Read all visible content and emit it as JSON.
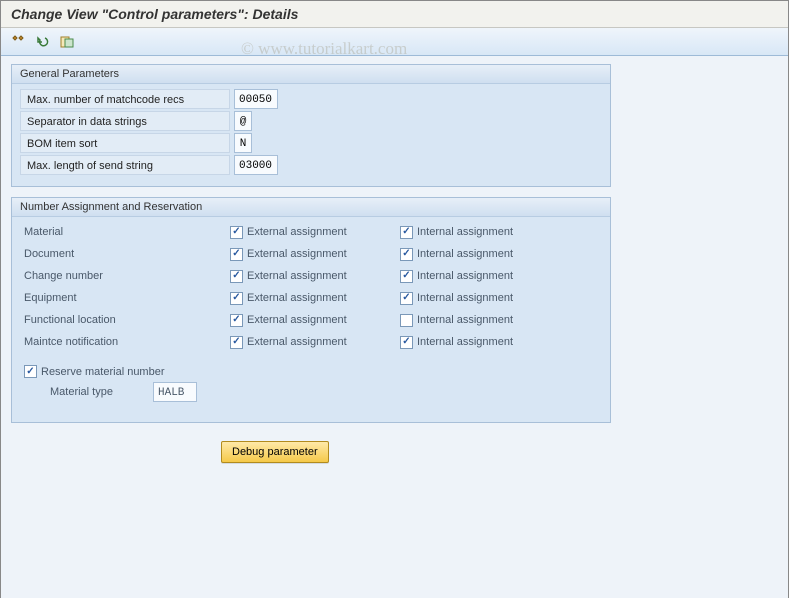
{
  "watermark": "© www.tutorialkart.com",
  "page_title": "Change View \"Control parameters\": Details",
  "toolbar_icons": [
    "pencil-icon",
    "undo-icon",
    "change-log-icon"
  ],
  "general_params": {
    "title": "General Parameters",
    "rows": [
      {
        "label": "Max. number of matchcode recs",
        "value": "00050",
        "width": "w50"
      },
      {
        "label": "Separator in data strings",
        "value": "@",
        "width": "w18"
      },
      {
        "label": "BOM item sort",
        "value": "N",
        "width": "w18"
      },
      {
        "label": "Max. length of send string",
        "value": "03000",
        "width": "w50"
      }
    ]
  },
  "number_assignment": {
    "title": "Number Assignment and Reservation",
    "col_labels": {
      "external": "External assignment",
      "internal": "Internal assignment"
    },
    "rows": [
      {
        "label": "Material",
        "external": true,
        "internal": true
      },
      {
        "label": "Document",
        "external": true,
        "internal": true
      },
      {
        "label": "Change number",
        "external": true,
        "internal": true
      },
      {
        "label": "Equipment",
        "external": true,
        "internal": true
      },
      {
        "label": "Functional location",
        "external": true,
        "internal": false
      },
      {
        "label": "Maintce notification",
        "external": true,
        "internal": true
      }
    ],
    "reserve": {
      "checked": true,
      "label": "Reserve material number"
    },
    "material_type": {
      "label": "Material type",
      "value": "HALB"
    }
  },
  "debug_button": "Debug parameter"
}
